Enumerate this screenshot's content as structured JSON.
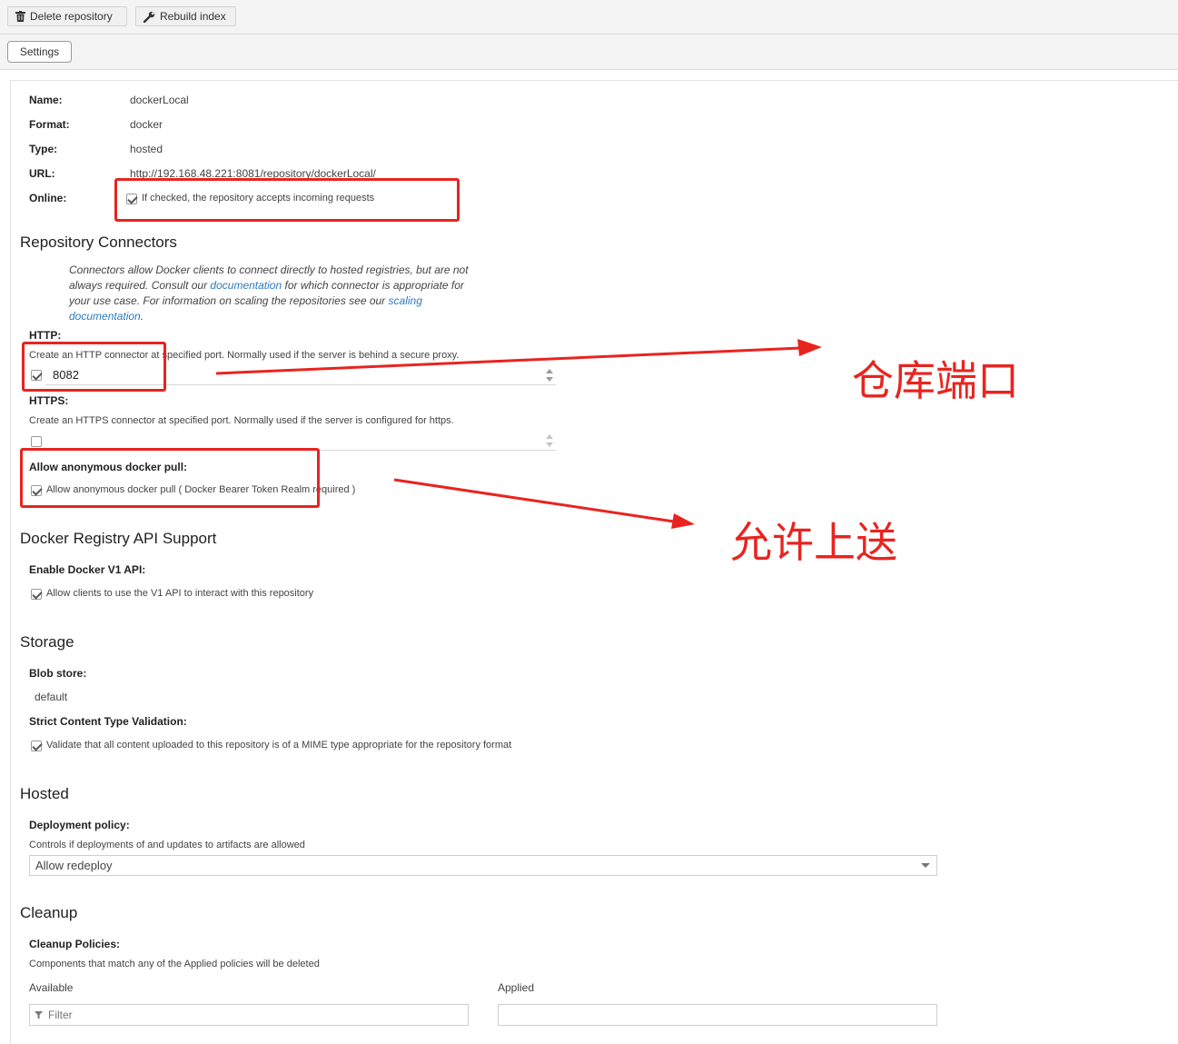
{
  "toolbar": {
    "delete_label": "Delete repository",
    "rebuild_label": "Rebuild index"
  },
  "tabs": {
    "settings_label": "Settings"
  },
  "info": {
    "name_label": "Name:",
    "name_value": "dockerLocal",
    "format_label": "Format:",
    "format_value": "docker",
    "type_label": "Type:",
    "type_value": "hosted",
    "url_label": "URL:",
    "url_value": "http://192.168.48.221:8081/repository/dockerLocal/",
    "online_label": "Online:",
    "online_help": "If checked, the repository accepts incoming requests",
    "online_checked": true
  },
  "connectors": {
    "title": "Repository Connectors",
    "desc_line1": "Connectors allow Docker clients to connect directly to hosted registries, but are not",
    "desc_line2_a": "always required. Consult our ",
    "desc_link_doc": "documentation",
    "desc_line2_b": " for which connector is appropriate for",
    "desc_line3_a": "your use case. For information on scaling the repositories see our ",
    "desc_link_scaling": "scaling",
    "desc_link_scaling2": "documentation",
    "desc_line4_tail": ".",
    "http_label": "HTTP:",
    "http_help": "Create an HTTP connector at specified port. Normally used if the server is behind a secure proxy.",
    "http_port": "8082",
    "http_checked": true,
    "https_label": "HTTPS:",
    "https_help": "Create an HTTPS connector at specified port. Normally used if the server is configured for https.",
    "https_port": "",
    "https_checked": false,
    "anon_label": "Allow anonymous docker pull:",
    "anon_help": "Allow anonymous docker pull ( Docker Bearer Token Realm required )",
    "anon_checked": true
  },
  "api": {
    "title": "Docker Registry API Support",
    "v1_label": "Enable Docker V1 API:",
    "v1_help": "Allow clients to use the V1 API to interact with this repository",
    "v1_checked": true
  },
  "storage": {
    "title": "Storage",
    "blob_label": "Blob store:",
    "blob_value": "default",
    "strict_label": "Strict Content Type Validation:",
    "strict_help": "Validate that all content uploaded to this repository is of a MIME type appropriate for the repository format",
    "strict_checked": true
  },
  "hosted": {
    "title": "Hosted",
    "policy_label": "Deployment policy:",
    "policy_help": "Controls if deployments of and updates to artifacts are allowed",
    "policy_value": "Allow redeploy"
  },
  "cleanup": {
    "title": "Cleanup",
    "policies_label": "Cleanup Policies:",
    "policies_help": "Components that match any of the Applied policies will be deleted",
    "available_label": "Available",
    "applied_label": "Applied",
    "filter_placeholder": "Filter"
  },
  "annotations": {
    "port_note": "仓库端口",
    "push_note": "允许上送",
    "color": "#e8241f"
  }
}
